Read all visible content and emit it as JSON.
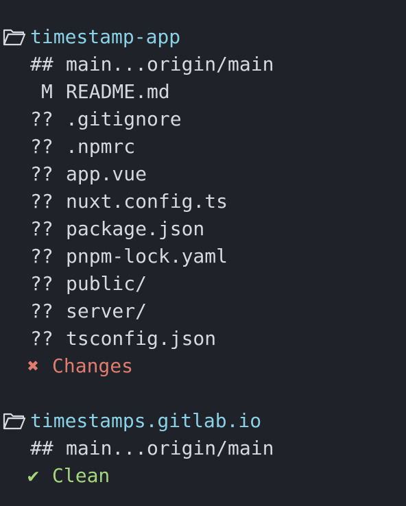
{
  "window": {
    "type": "terminal",
    "background": "#1f2329"
  },
  "icons": {
    "folder": "folder-open-icon",
    "cross": "cross-mark-icon",
    "check": "check-mark-icon"
  },
  "colors": {
    "repo_name": "#8ad1e6",
    "default_text": "#d6d9df",
    "changes": "#e07b6f",
    "clean": "#a6d67c"
  },
  "repos": [
    {
      "name": "timestamp-app",
      "branch_marker": "##",
      "branch": "main...origin/main",
      "entries": [
        {
          "code": "M",
          "path": "README.md"
        },
        {
          "code": "??",
          "path": ".gitignore"
        },
        {
          "code": "??",
          "path": ".npmrc"
        },
        {
          "code": "??",
          "path": "app.vue"
        },
        {
          "code": "??",
          "path": "nuxt.config.ts"
        },
        {
          "code": "??",
          "path": "package.json"
        },
        {
          "code": "??",
          "path": "pnpm-lock.yaml"
        },
        {
          "code": "??",
          "path": "public/"
        },
        {
          "code": "??",
          "path": "server/"
        },
        {
          "code": "??",
          "path": "tsconfig.json"
        }
      ],
      "status_symbol": "✖",
      "status_label": "Changes"
    },
    {
      "name": "timestamps.gitlab.io",
      "branch_marker": "##",
      "branch": "main...origin/main",
      "entries": [],
      "status_symbol": "✔",
      "status_label": "Clean"
    }
  ]
}
